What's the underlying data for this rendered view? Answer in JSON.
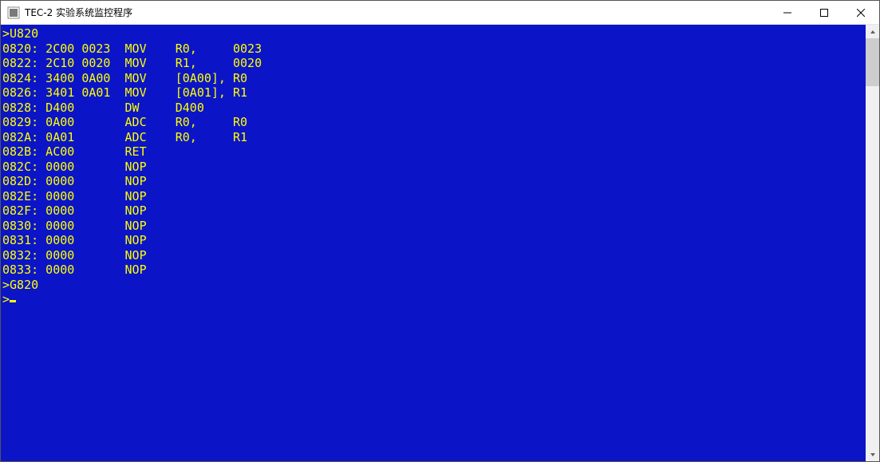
{
  "window": {
    "title": "TEC-2 实验系统监控程序"
  },
  "terminal": {
    "lines": [
      ">U820",
      "0820: 2C00 0023  MOV    R0,     0023",
      "0822: 2C10 0020  MOV    R1,     0020",
      "0824: 3400 0A00  MOV    [0A00], R0",
      "0826: 3401 0A01  MOV    [0A01], R1",
      "0828: D400       DW     D400",
      "0829: 0A00       ADC    R0,     R0",
      "082A: 0A01       ADC    R0,     R1",
      "082B: AC00       RET",
      "082C: 0000       NOP",
      "082D: 0000       NOP",
      "082E: 0000       NOP",
      "082F: 0000       NOP",
      "0830: 0000       NOP",
      "0831: 0000       NOP",
      "0832: 0000       NOP",
      "0833: 0000       NOP",
      ">G820",
      ">"
    ]
  }
}
